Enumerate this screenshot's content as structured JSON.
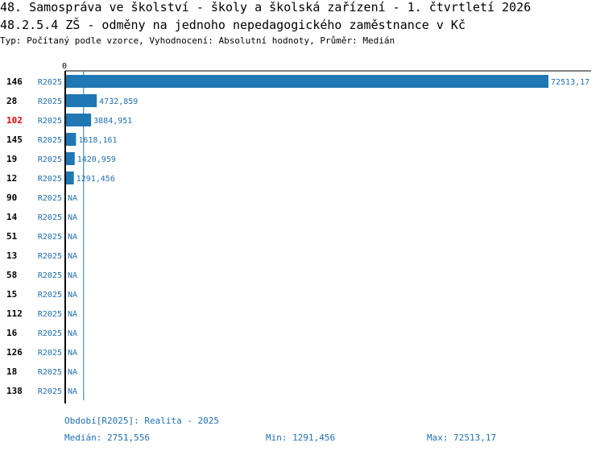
{
  "header": {
    "title1": "48. Samospráva ve školství - školy a školská zařízení - 1. čtvrtletí 2026",
    "title2": "48.2.5.4 ZŠ - odměny na jednoho nepedagogického zaměstnance v Kč",
    "subtitle": "Typ: Počítaný podle vzorce, Vyhodnocení: Absolutní hodnoty, Průměr: Medián"
  },
  "colors": {
    "bar": "#1f77b4",
    "label": "#1f6fb4",
    "highlight": "#e00000",
    "axis": "#000000"
  },
  "chart_data": {
    "type": "bar",
    "orientation": "horizontal",
    "axis_zero_label": "0",
    "median_line": 2751.556,
    "xlim": [
      0,
      72513.17
    ],
    "rows": [
      {
        "id": "146",
        "period": "R2025",
        "value": 72513.17,
        "label": "72513,17",
        "highlight": false
      },
      {
        "id": "28",
        "period": "R2025",
        "value": 4732.859,
        "label": "4732,859",
        "highlight": false
      },
      {
        "id": "102",
        "period": "R2025",
        "value": 3884.951,
        "label": "3884,951",
        "highlight": true
      },
      {
        "id": "145",
        "period": "R2025",
        "value": 1618.161,
        "label": "1618,161",
        "highlight": false
      },
      {
        "id": "19",
        "period": "R2025",
        "value": 1420.959,
        "label": "1420,959",
        "highlight": false
      },
      {
        "id": "12",
        "period": "R2025",
        "value": 1291.456,
        "label": "1291,456",
        "highlight": false
      },
      {
        "id": "90",
        "period": "R2025",
        "value": null,
        "label": "NA",
        "highlight": false
      },
      {
        "id": "14",
        "period": "R2025",
        "value": null,
        "label": "NA",
        "highlight": false
      },
      {
        "id": "51",
        "period": "R2025",
        "value": null,
        "label": "NA",
        "highlight": false
      },
      {
        "id": "13",
        "period": "R2025",
        "value": null,
        "label": "NA",
        "highlight": false
      },
      {
        "id": "58",
        "period": "R2025",
        "value": null,
        "label": "NA",
        "highlight": false
      },
      {
        "id": "15",
        "period": "R2025",
        "value": null,
        "label": "NA",
        "highlight": false
      },
      {
        "id": "112",
        "period": "R2025",
        "value": null,
        "label": "NA",
        "highlight": false
      },
      {
        "id": "16",
        "period": "R2025",
        "value": null,
        "label": "NA",
        "highlight": false
      },
      {
        "id": "126",
        "period": "R2025",
        "value": null,
        "label": "NA",
        "highlight": false
      },
      {
        "id": "18",
        "period": "R2025",
        "value": null,
        "label": "NA",
        "highlight": false
      },
      {
        "id": "138",
        "period": "R2025",
        "value": null,
        "label": "NA",
        "highlight": false
      }
    ]
  },
  "footer": {
    "period": "Období[R2025]: Realita - 2025",
    "median": "Medián: 2751,556",
    "min": "Min: 1291,456",
    "max": "Max: 72513,17"
  }
}
